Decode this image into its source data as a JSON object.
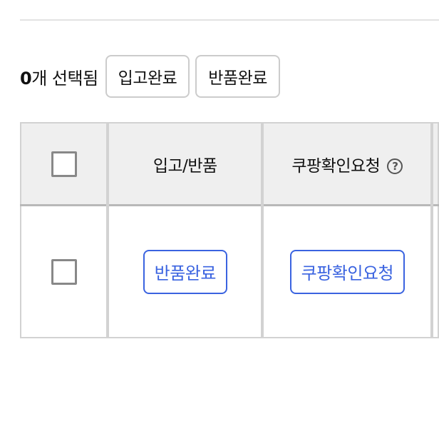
{
  "selection": {
    "count": "0",
    "suffix": "개 선택됨"
  },
  "toolbar": {
    "receive_complete_label": "입고완료",
    "return_complete_label": "반품완료"
  },
  "table": {
    "headers": {
      "inout": "입고/반품",
      "coupang_check": "쿠팡확인요청",
      "help_symbol": "?"
    },
    "rows": [
      {
        "status_button": "반품완료",
        "coupang_button": "쿠팡확인요청"
      }
    ]
  },
  "colors": {
    "accent": "#3a63e0",
    "header_bg": "#efefef",
    "border": "#d2d2d2"
  }
}
